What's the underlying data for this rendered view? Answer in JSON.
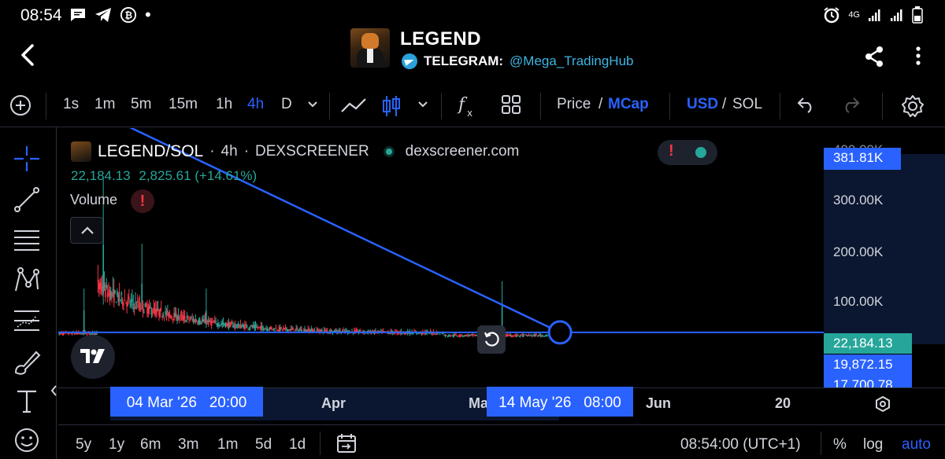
{
  "status_bar": {
    "time": "08:54",
    "network": "4G",
    "left_icons": [
      "chat-icon",
      "telegram-icon",
      "bitcoin-icon"
    ],
    "right_icons": [
      "alarm-icon",
      "signal-icon",
      "signal-icon",
      "battery-icon"
    ]
  },
  "header": {
    "title": "LEGEND",
    "telegram_prefix": "TELEGRAM:",
    "telegram_handle": "@Mega_TradingHub"
  },
  "toolbar": {
    "intervals": [
      "1s",
      "1m",
      "5m",
      "15m",
      "1h",
      "4h",
      "D"
    ],
    "active_interval": "4h",
    "price_label": "Price",
    "slash": "/",
    "mcap_label": "MCap",
    "usd_label": "USD",
    "sol_label": "SOL"
  },
  "chart": {
    "symbol": "LEGEND/SOL",
    "dot": "·",
    "interval": "4h",
    "exchange": "DEXSCREENER",
    "source": "dexscreener.com",
    "ohlc_value": "22,184.13",
    "ohlc_change": "2,825.61 (+14.61%)",
    "volume_label": "Volume",
    "warn": "!"
  },
  "price_scale": {
    "ticks": [
      "300.00K",
      "200.00K",
      "100.00K"
    ],
    "top_partial": "400.00K",
    "crosshair_price": "381.81K",
    "last_price": "22,184.13",
    "tag_2": "19,872.15",
    "tag_3": "17,700.78"
  },
  "time_scale": {
    "labels": [
      "Apr",
      "Jun",
      "20"
    ],
    "partial_label": "Ma",
    "crosshair_start": "04 Mar '26   20:00",
    "crosshair_end": "14 May '26   08:00"
  },
  "bottom_bar": {
    "ranges": [
      "5y",
      "1y",
      "6m",
      "3m",
      "1m",
      "5d",
      "1d"
    ],
    "clock": "08:54:00 (UTC+1)",
    "percent": "%",
    "log": "log",
    "auto": "auto"
  },
  "colors": {
    "accent": "#2962ff",
    "up": "#26a69a",
    "down": "#f23645",
    "price_line": "#2962ff",
    "last_price_tag": "#26a69a"
  },
  "chart_data": {
    "type": "candlestick",
    "title": "LEGEND/SOL",
    "interval": "4h",
    "y_unit": "MCap USD",
    "ylim": [
      0,
      400000
    ],
    "x_range": [
      "2026-02-25",
      "2026-06-24"
    ],
    "trend_line": {
      "from": {
        "x": "2026-03-07",
        "y": 440000
      },
      "to": {
        "x": "2026-05-14",
        "y": 22184
      }
    },
    "horizontal_line": 22184.13,
    "notable_points": [
      {
        "date": "2026-03-04",
        "high": 330000,
        "label": "peak"
      },
      {
        "date": "2026-03-01",
        "high": 110000
      },
      {
        "date": "2026-03-10",
        "high": 200000
      },
      {
        "date": "2026-03-20",
        "high": 110000
      },
      {
        "date": "2026-05-05",
        "high": 125000
      },
      {
        "date": "2026-05-14",
        "close": 22184.13
      }
    ]
  }
}
